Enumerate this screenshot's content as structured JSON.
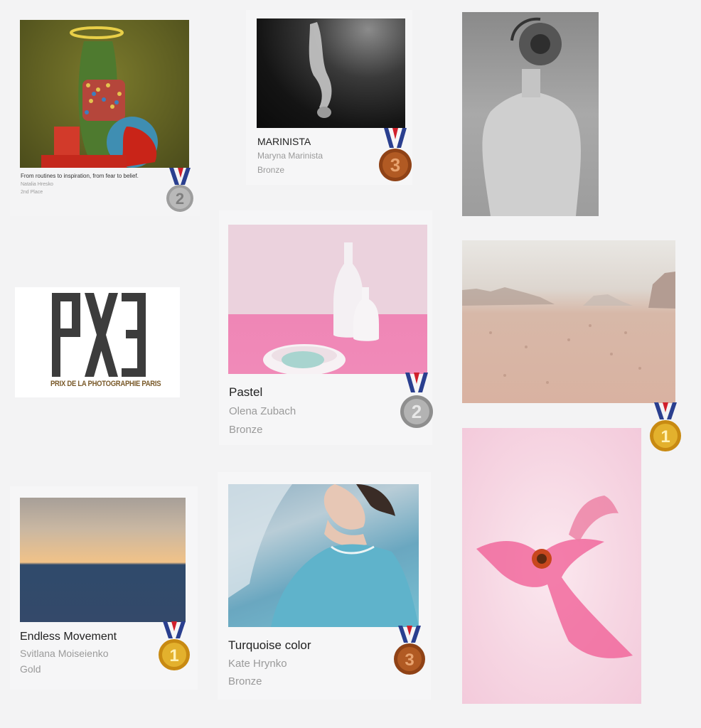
{
  "entries": [
    {
      "title": "From routines to inspiration, from fear to belief.",
      "author": "Natalia Hresko",
      "award": "2nd Place",
      "medal": "2"
    },
    {
      "title": "MARINISTA",
      "author": "Maryna Marinista",
      "award": "Bronze",
      "medal": "3"
    },
    {
      "title": "Pastel",
      "author": "Olena Zubach",
      "award": "Bronze",
      "medal": "2"
    },
    {
      "title": "Endless Movement",
      "author": "Svitlana Moiseienko",
      "award": "Gold",
      "medal": "1"
    },
    {
      "title": "Turquoise color",
      "author": "Kate Hrynko",
      "award": "Bronze",
      "medal": "3"
    }
  ],
  "desert_medal": "1",
  "logo": {
    "mark": "PX3",
    "tagline": "PRIX DE LA PHOTOGRAPHIE PARIS"
  },
  "colors": {
    "gold": "#d9a21e",
    "silver": "#a6a6a6",
    "bronze": "#b15a23",
    "ribbon_blue": "#2a3f8f",
    "ribbon_red": "#d0202b"
  }
}
